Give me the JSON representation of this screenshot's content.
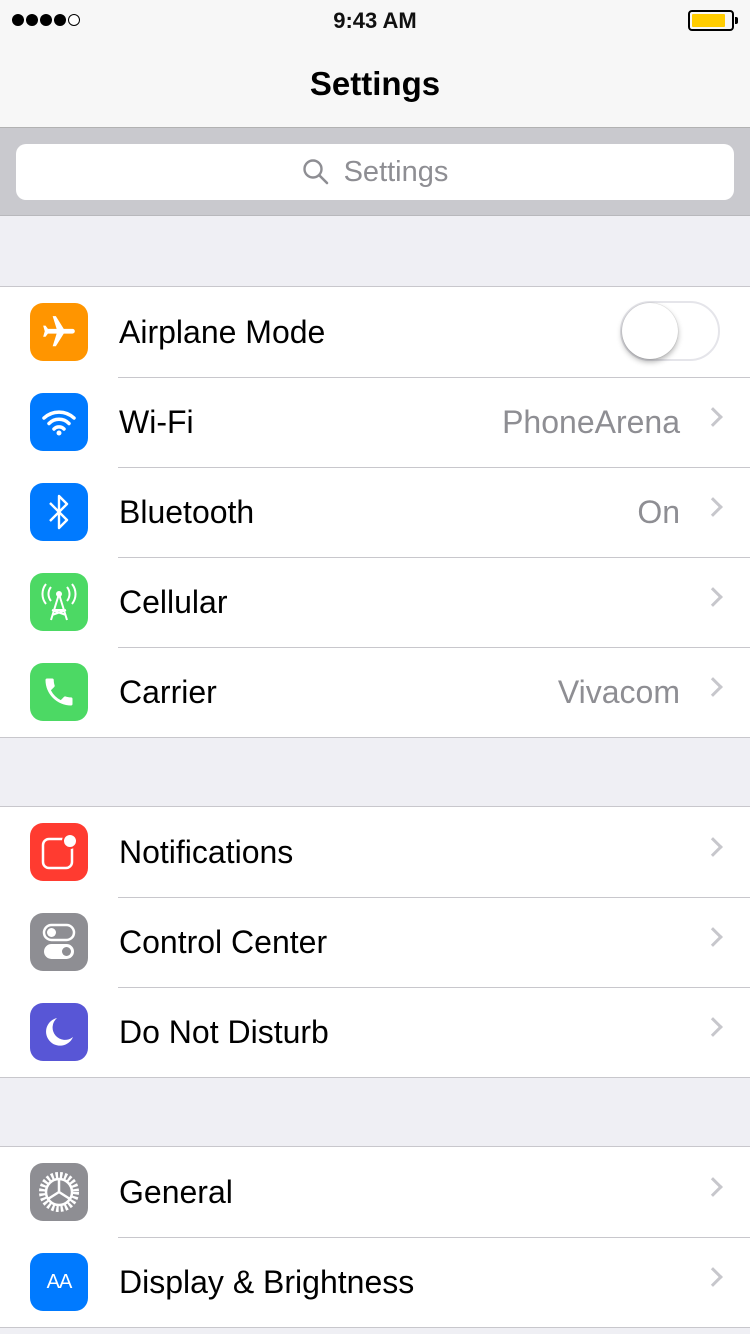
{
  "status_bar": {
    "time": "9:43 AM",
    "signal_bars": 4,
    "signal_max": 5,
    "battery_level": 0.88,
    "battery_color": "#ffcc00"
  },
  "nav": {
    "title": "Settings"
  },
  "search": {
    "placeholder": "Settings"
  },
  "groups": [
    [
      {
        "label": "Airplane Mode",
        "icon": "airplane-icon",
        "color": "#ff9500",
        "toggle": false
      },
      {
        "label": "Wi-Fi",
        "value": "PhoneArena",
        "icon": "wifi-icon",
        "color": "#007aff"
      },
      {
        "label": "Bluetooth",
        "value": "On",
        "icon": "bluetooth-icon",
        "color": "#007aff"
      },
      {
        "label": "Cellular",
        "icon": "cellular-icon",
        "color": "#4cd964"
      },
      {
        "label": "Carrier",
        "value": "Vivacom",
        "icon": "phone-icon",
        "color": "#4cd964"
      }
    ],
    [
      {
        "label": "Notifications",
        "icon": "notifications-icon",
        "color": "#ff3b30"
      },
      {
        "label": "Control Center",
        "icon": "control-center-icon",
        "color": "#8e8e93"
      },
      {
        "label": "Do Not Disturb",
        "icon": "moon-icon",
        "color": "#5856d6"
      }
    ],
    [
      {
        "label": "General",
        "icon": "gear-icon",
        "color": "#8e8e93"
      },
      {
        "label": "Display & Brightness",
        "icon": "display-brightness-icon",
        "color": "#007aff",
        "icon_text": "AA"
      }
    ]
  ]
}
